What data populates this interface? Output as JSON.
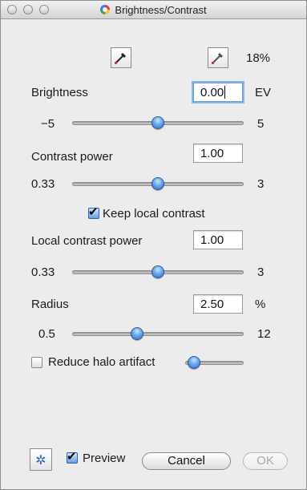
{
  "window": {
    "title": "Brightness/Contrast"
  },
  "picker": {
    "percent": "18%"
  },
  "brightness": {
    "label": "Brightness",
    "value": "0.00",
    "unit": "EV",
    "min": "−5",
    "max": "5",
    "slider_fraction": 0.5
  },
  "contrast_power": {
    "label": "Contrast power",
    "value": "1.00",
    "min": "0.33",
    "max": "3",
    "slider_fraction": 0.5
  },
  "keep_local_contrast": {
    "label": "Keep local contrast",
    "checked": true
  },
  "local_contrast_power": {
    "label": "Local contrast power",
    "value": "1.00",
    "min": "0.33",
    "max": "3",
    "slider_fraction": 0.5
  },
  "radius": {
    "label": "Radius",
    "value": "2.50",
    "unit": "%",
    "min": "0.5",
    "max": "12",
    "slider_fraction": 0.38
  },
  "reduce_halo": {
    "label": "Reduce halo artifact",
    "checked": false,
    "slider_fraction": 0.15
  },
  "footer": {
    "preview_label": "Preview",
    "preview_checked": true,
    "cancel_label": "Cancel",
    "ok_label": "OK"
  },
  "icons": {
    "close": "traffic-light-close",
    "minimize": "traffic-light-minimize",
    "zoom": "traffic-light-zoom",
    "title": "color-wheel",
    "picker_black": "eyedropper",
    "picker_white": "eyedropper",
    "options": "gear"
  },
  "colors": {
    "slider_knob": "#4a8ad8",
    "focus_ring": "#8db4e8",
    "checkbox_checked": "#6aa0e6"
  }
}
